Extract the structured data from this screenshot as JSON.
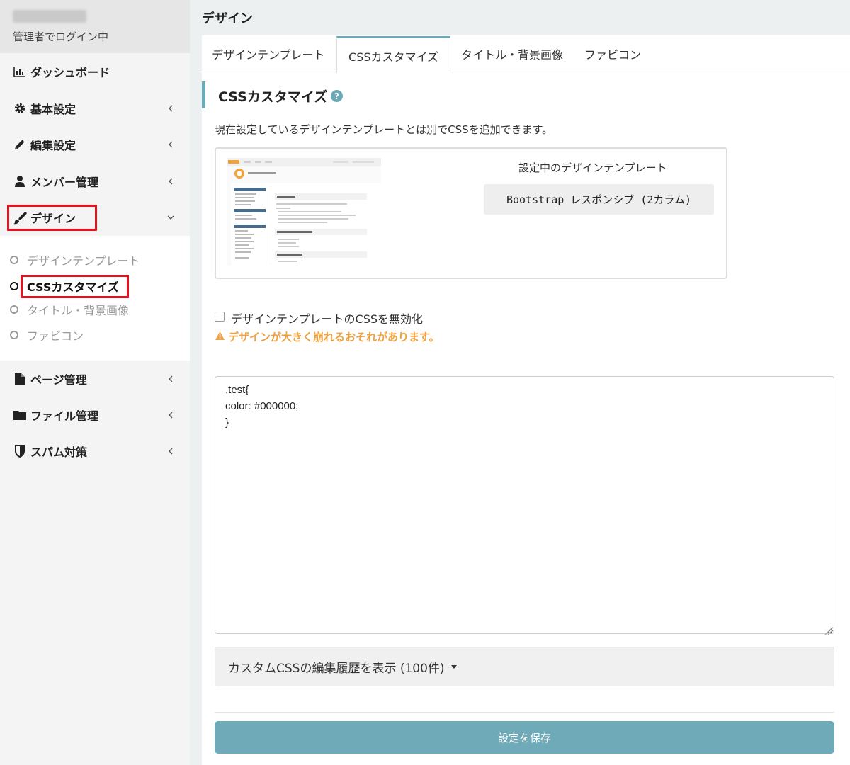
{
  "sidebar": {
    "user_status": "管理者でログイン中",
    "nav": [
      {
        "label": "ダッシュボード",
        "icon": "bar-chart-icon"
      },
      {
        "label": "基本設定",
        "icon": "gear-icon"
      },
      {
        "label": "編集設定",
        "icon": "pencil-icon"
      },
      {
        "label": "メンバー管理",
        "icon": "user-icon"
      },
      {
        "label": "デザイン",
        "icon": "paintbrush-icon"
      },
      {
        "label": "ページ管理",
        "icon": "file-icon"
      },
      {
        "label": "ファイル管理",
        "icon": "folder-icon"
      },
      {
        "label": "スパム対策",
        "icon": "shield-icon"
      }
    ],
    "design_subnav": [
      {
        "label": "デザインテンプレート"
      },
      {
        "label": "CSSカスタマイズ",
        "active": true
      },
      {
        "label": "タイトル・背景画像"
      },
      {
        "label": "ファビコン"
      }
    ]
  },
  "header": {
    "title": "デザイン"
  },
  "tabs": [
    {
      "label": "デザインテンプレート"
    },
    {
      "label": "CSSカスタマイズ",
      "active": true
    },
    {
      "label": "タイトル・背景画像"
    },
    {
      "label": "ファビコン"
    }
  ],
  "section": {
    "title": "CSSカスタマイズ",
    "help": "?",
    "description": "現在設定しているデザインテンプレートとは別でCSSを追加できます。"
  },
  "template": {
    "current_label": "設定中のデザインテンプレート",
    "current_value": "Bootstrap レスポンシブ (2カラム)"
  },
  "disable_option": {
    "label": "デザインテンプレートのCSSを無効化",
    "checked": false,
    "warning": "デザインが大きく崩れるおそれがあります。"
  },
  "editor": {
    "content": ".test{\ncolor: #000000;\n}"
  },
  "history": {
    "label": "カスタムCSSの編集履歴を表示 (100件)"
  },
  "save_label": "設定を保存",
  "colors": {
    "accent": "#6aa9b6",
    "warning": "#f0a140",
    "highlight": "#e0141e"
  }
}
